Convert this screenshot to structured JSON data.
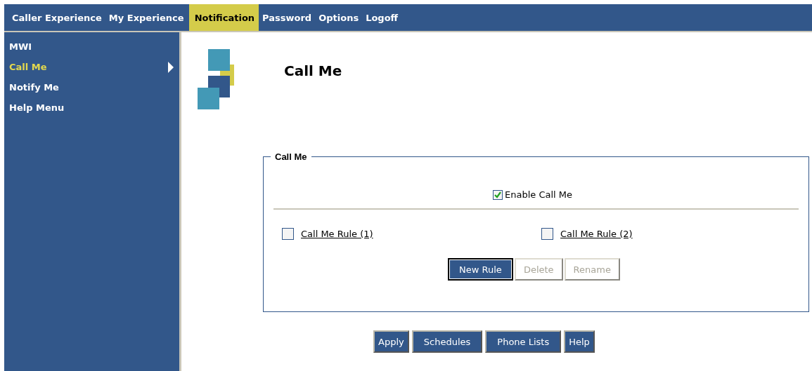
{
  "nav": {
    "tabs": [
      {
        "label": "Caller Experience",
        "selected": false
      },
      {
        "label": "My Experience",
        "selected": false
      },
      {
        "label": "Notification",
        "selected": true
      },
      {
        "label": "Password",
        "selected": false
      },
      {
        "label": "Options",
        "selected": false
      },
      {
        "label": "Logoff",
        "selected": false
      }
    ]
  },
  "sidebar": {
    "items": [
      {
        "label": "MWI",
        "selected": false
      },
      {
        "label": "Call Me",
        "selected": true
      },
      {
        "label": "Notify Me",
        "selected": false
      },
      {
        "label": "Help Menu",
        "selected": false
      }
    ]
  },
  "page_title": "Call Me",
  "group": {
    "legend": "Call Me",
    "enable": {
      "label": "Enable Call Me",
      "checked": true
    },
    "rules": [
      {
        "label": "Call Me Rule (1)",
        "checked": false
      },
      {
        "label": "Call Me Rule (2)",
        "checked": false
      }
    ],
    "buttons": [
      {
        "label": "New Rule",
        "disabled": false
      },
      {
        "label": "Delete",
        "disabled": true
      },
      {
        "label": "Rename",
        "disabled": true
      }
    ]
  },
  "footer_buttons": [
    "Apply",
    "Schedules",
    "Phone Lists",
    "Help"
  ]
}
